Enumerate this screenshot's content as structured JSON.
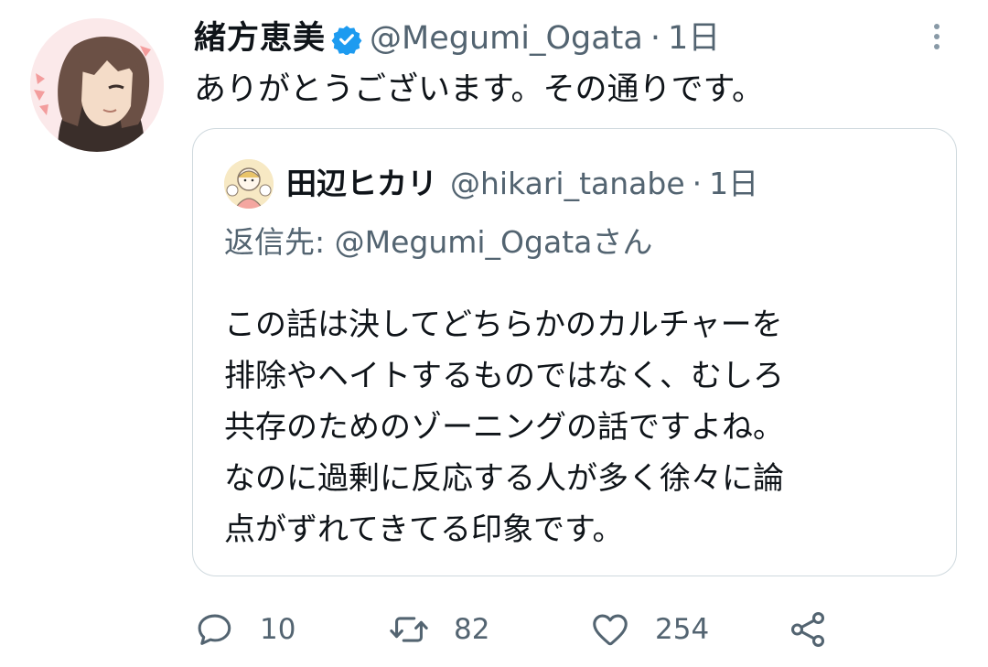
{
  "tweet": {
    "display_name": "緒方恵美",
    "handle": "@Megumi_Ogata",
    "separator": "·",
    "time": "1日",
    "text": "ありがとうございます。その通りです。",
    "verified": true
  },
  "quoted_tweet": {
    "display_name": "田辺ヒカリ",
    "handle": "@hikari_tanabe",
    "separator": "·",
    "time": "1日",
    "reply_to": "返信先: @Megumi_Ogataさん",
    "lines": [
      "この話は決してどちらかのカルチャーを",
      "排除やヘイトするものではなく、むしろ",
      "共存のためのゾーニングの話ですよね。",
      "なのに過剰に反応する人が多く徐々に論",
      "点がずれてきてる印象です。"
    ]
  },
  "actions": {
    "reply_count": "10",
    "retweet_count": "82",
    "like_count": "254"
  },
  "icons": {
    "verified": "verified-badge-icon",
    "more": "more-vertical-icon",
    "reply": "reply-bubble-icon",
    "retweet": "retweet-icon",
    "like": "heart-icon",
    "share": "share-icon"
  },
  "colors": {
    "text": "#0f1419",
    "secondary": "#536471",
    "verified": "#1d9bf0",
    "border": "#cfd9de"
  }
}
